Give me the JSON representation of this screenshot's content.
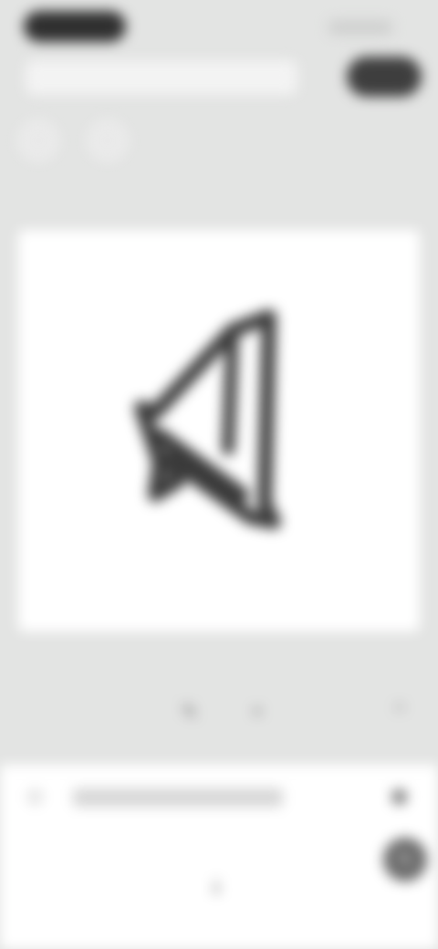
{
  "header": {
    "title": "",
    "primary_button": ""
  },
  "icons": {
    "status": "status-pill",
    "left_action": "circle-icon",
    "right_action": "circle-icon"
  },
  "canvas": {
    "stroke_color": "#3a3a3a",
    "background": "#ffffff"
  },
  "toolbar": {
    "tools": [
      "pen-tool",
      "eraser-tool",
      "more-tool"
    ]
  },
  "sheet": {
    "row_label": "",
    "fab_icon": "edit-icon"
  },
  "colors": {
    "background": "#e3e4e3",
    "dark": "#3e3e3e"
  }
}
